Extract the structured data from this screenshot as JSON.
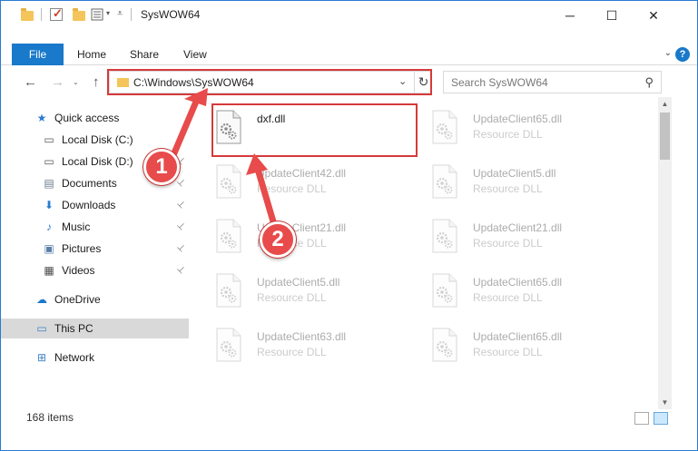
{
  "window": {
    "title": "SysWOW64",
    "minimize_glyph": "─",
    "maximize_glyph": "☐",
    "close_glyph": "✕"
  },
  "ribbon": {
    "tabs": [
      "File",
      "Home",
      "Share",
      "View"
    ],
    "help_glyph": "?"
  },
  "address_bar": {
    "path": "C:\\Windows\\SysWOW64",
    "dropdown_glyph": "⌄",
    "refresh_glyph": "↻"
  },
  "search": {
    "placeholder": "Search SysWOW64",
    "icon_glyph": "⚲"
  },
  "nav_buttons": {
    "back": "←",
    "forward": "→",
    "up": "↑"
  },
  "nav_pane": {
    "items": [
      {
        "label": "Quick access",
        "icon": "star-icon",
        "glyph": "★",
        "color": "#2b7bd1"
      },
      {
        "label": "Local Disk (C:)",
        "icon": "drive-icon",
        "glyph": "▭",
        "color": "#555555",
        "pinned": true
      },
      {
        "label": "Local Disk (D:)",
        "icon": "drive-icon",
        "glyph": "▭",
        "color": "#555555",
        "pinned": true
      },
      {
        "label": "Documents",
        "icon": "documents-icon",
        "glyph": "▤",
        "color": "#6a7b8c",
        "pinned": true
      },
      {
        "label": "Downloads",
        "icon": "downloads-icon",
        "glyph": "⬇",
        "color": "#2b7bd1",
        "pinned": true
      },
      {
        "label": "Music",
        "icon": "music-icon",
        "glyph": "♪",
        "color": "#2b7bd1",
        "pinned": true
      },
      {
        "label": "Pictures",
        "icon": "pictures-icon",
        "glyph": "▣",
        "color": "#5a7ea8",
        "pinned": true
      },
      {
        "label": "Videos",
        "icon": "videos-icon",
        "glyph": "▦",
        "color": "#4a4a4a",
        "pinned": true
      },
      {
        "label": "OneDrive",
        "icon": "onedrive-icon",
        "glyph": "☁",
        "color": "#1979ca"
      },
      {
        "label": "This PC",
        "icon": "computer-icon",
        "glyph": "▭",
        "color": "#3f83c7",
        "selected": true
      },
      {
        "label": "Network",
        "icon": "network-icon",
        "glyph": "⊞",
        "color": "#3f83c7"
      }
    ],
    "pin_glyph": "📌"
  },
  "files": [
    {
      "name": "dxf.dll",
      "type": "",
      "highlighted": true
    },
    {
      "name": "UpdateClient65.dll",
      "type": "Resource DLL"
    },
    {
      "name": "UpdateClient42.dll",
      "type": "Resource DLL"
    },
    {
      "name": "UpdateClient5.dll",
      "type": "Resource DLL"
    },
    {
      "name": "UpdateClient21.dll",
      "type": "Resource DLL"
    },
    {
      "name": "UpdateClient21.dll",
      "type": "Resource DLL"
    },
    {
      "name": "UpdateClient5.dll",
      "type": "Resource DLL"
    },
    {
      "name": "UpdateClient65.dll",
      "type": "Resource DLL"
    },
    {
      "name": "UpdateClient63.dll",
      "type": "Resource DLL"
    },
    {
      "name": "UpdateClient65.dll",
      "type": "Resource DLL"
    }
  ],
  "status_bar": {
    "item_count": "168 items"
  },
  "callouts": [
    "1",
    "2"
  ],
  "colors": {
    "accent": "#1979ca",
    "highlight_red": "#d63a3a",
    "callout_red": "#e84b4b"
  }
}
